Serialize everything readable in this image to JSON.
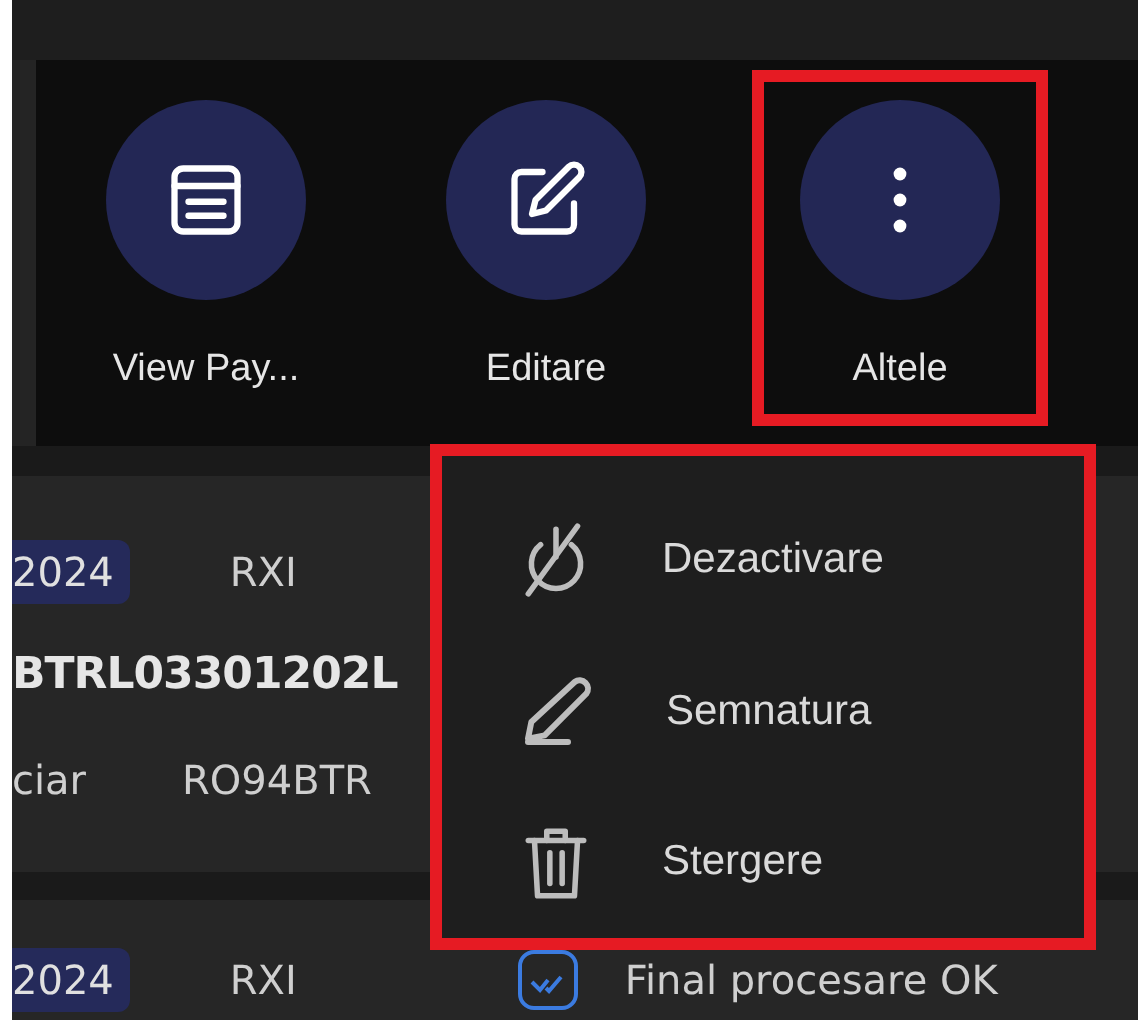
{
  "actions": [
    {
      "kind": "view",
      "label": "View Pay...",
      "highlighted": false
    },
    {
      "kind": "edit",
      "label": "Editare",
      "highlighted": false
    },
    {
      "kind": "more",
      "label": "Altele",
      "highlighted": true
    }
  ],
  "menu": {
    "highlighted": true,
    "items": [
      {
        "kind": "disable",
        "label": "Dezactivare"
      },
      {
        "kind": "sign",
        "label": "Semnatura"
      },
      {
        "kind": "delete",
        "label": "Stergere"
      }
    ]
  },
  "cards": [
    {
      "badge": "2024",
      "code": "RXI",
      "reference": "BTRL03301202L",
      "field_label": "ciar",
      "account": "RO94BTR"
    },
    {
      "badge": "2024",
      "code": "RXI",
      "status": "Final procesare OK"
    }
  ]
}
